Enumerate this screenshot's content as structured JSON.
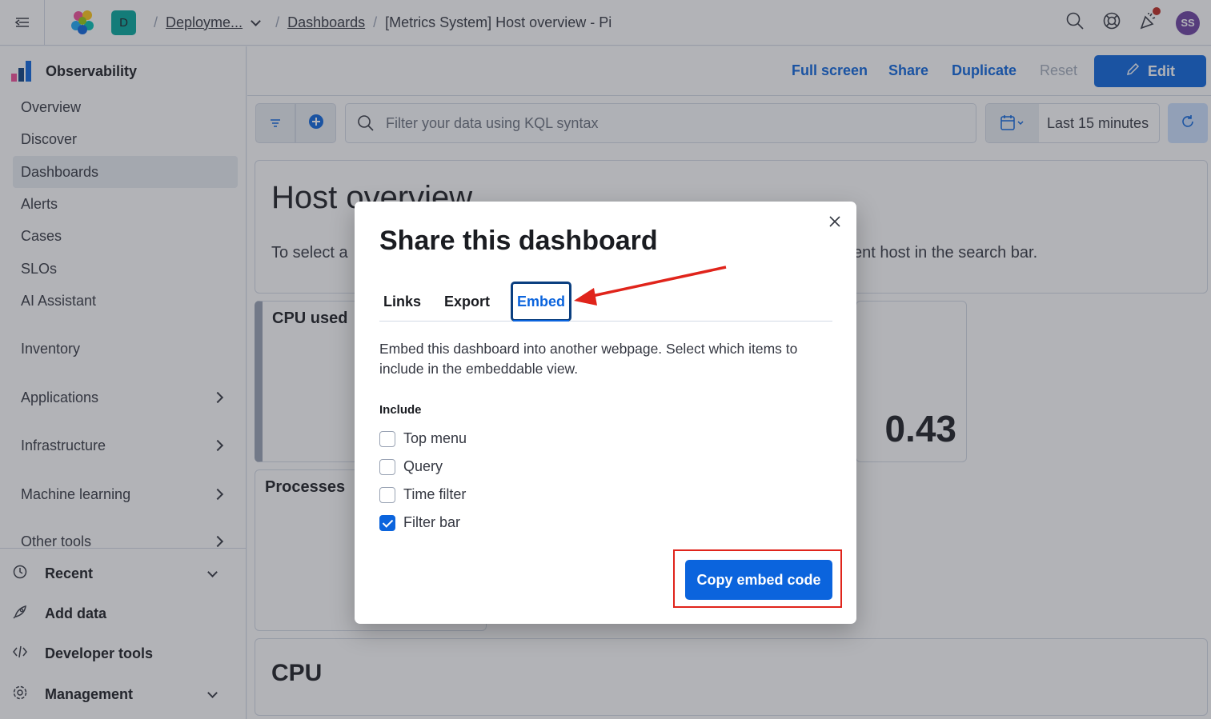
{
  "header": {
    "deployment_badge": "D",
    "breadcrumbs": [
      "Deployme...",
      "Dashboards",
      "[Metrics System] Host overview - Pi"
    ],
    "avatar_initials": "SS"
  },
  "sidebar": {
    "title": "Observability",
    "items": [
      "Overview",
      "Discover",
      "Dashboards",
      "Alerts",
      "Cases",
      "SLOs",
      "AI Assistant",
      "Inventory",
      "Applications",
      "Infrastructure",
      "Machine learning",
      "Other tools"
    ],
    "active_item": "Dashboards",
    "bottom": [
      "Recent",
      "Add data",
      "Developer tools",
      "Management"
    ]
  },
  "toolbar": {
    "full_screen": "Full screen",
    "share": "Share",
    "duplicate": "Duplicate",
    "reset": "Reset",
    "edit": "Edit"
  },
  "query": {
    "placeholder": "Filter your data using KQL syntax",
    "time_range": "Last 15 minutes"
  },
  "dashboard": {
    "title": "Host overview",
    "desc_left": "To select a",
    "desc_right": "ent host in the search bar.",
    "panel_cpu_used": "CPU used",
    "metric_value": "0.43",
    "panel_processes": "Processes",
    "panel_cpu": "CPU"
  },
  "modal": {
    "title": "Share this dashboard",
    "tabs": [
      "Links",
      "Export",
      "Embed"
    ],
    "selected_tab": "Embed",
    "description": "Embed this dashboard into another webpage. Select which items to include in the embeddable view.",
    "include_label": "Include",
    "options": [
      {
        "label": "Top menu",
        "checked": false
      },
      {
        "label": "Query",
        "checked": false
      },
      {
        "label": "Time filter",
        "checked": false
      },
      {
        "label": "Filter bar",
        "checked": true
      }
    ],
    "copy_button": "Copy embed code"
  },
  "colors": {
    "primary": "#0b64dd",
    "annotation_red": "#e0241b"
  }
}
